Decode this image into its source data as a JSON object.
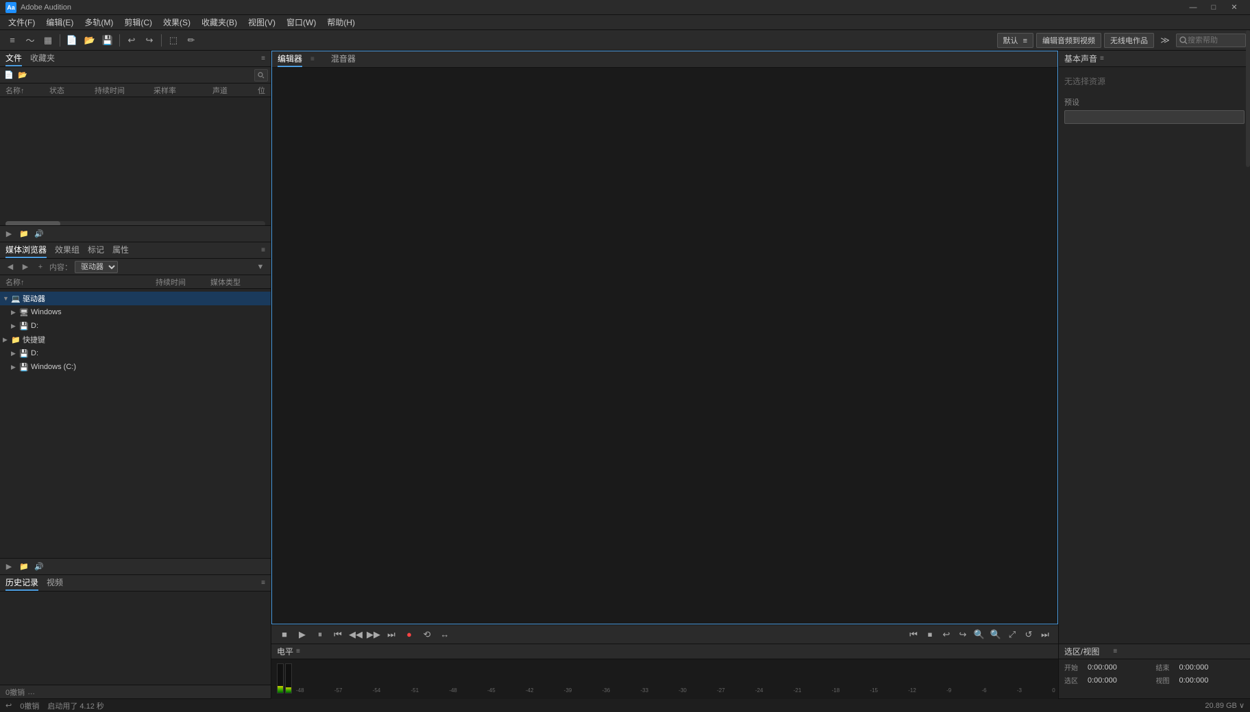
{
  "titlebar": {
    "app_name": "Adobe Audition",
    "logo_text": "Aa",
    "min_btn": "—",
    "max_btn": "□",
    "close_btn": "✕"
  },
  "menubar": {
    "items": [
      {
        "id": "file",
        "label": "文件(F)"
      },
      {
        "id": "edit",
        "label": "编辑(E)"
      },
      {
        "id": "multitrack",
        "label": "多轨(M)"
      },
      {
        "id": "clip",
        "label": "剪辑(C)"
      },
      {
        "id": "effect",
        "label": "效果(S)"
      },
      {
        "id": "favorites",
        "label": "收藏夹(B)"
      },
      {
        "id": "view",
        "label": "视图(V)"
      },
      {
        "id": "window",
        "label": "窗口(W)"
      },
      {
        "id": "help",
        "label": "帮助(H)"
      }
    ]
  },
  "toolbar": {
    "workspace_label": "默认",
    "workspace_icon": "≡",
    "edit_video_label": "编辑音频到视频",
    "wireless_label": "无线电作品",
    "expand_icon": "≫",
    "search_placeholder": "搜索帮助"
  },
  "left_panel": {
    "files_tab": "文件",
    "favorites_tab": "收藏夹",
    "menu_icon": "≡",
    "columns": {
      "name": "名称↑",
      "status": "状态",
      "duration": "持续时间",
      "samplerate": "采样率",
      "channel": "声道",
      "more": "位"
    },
    "bottom_icons": [
      "▶",
      "🗂",
      "🔊"
    ]
  },
  "media_browser": {
    "tabs": [
      {
        "id": "browser",
        "label": "媒体浏览器"
      },
      {
        "id": "effects",
        "label": "效果组"
      },
      {
        "id": "markers",
        "label": "标记"
      },
      {
        "id": "properties",
        "label": "属性"
      }
    ],
    "menu_icon": "≡",
    "content_label": "内容：",
    "content_value": "驱动器",
    "tree_items": [
      {
        "id": "drives",
        "label": "驱动器",
        "level": 0,
        "expanded": true,
        "icon": "💻",
        "type": "root"
      },
      {
        "id": "windows",
        "label": "Windows",
        "level": 1,
        "expanded": false,
        "icon": "🖥",
        "type": "drive"
      },
      {
        "id": "d_drive",
        "label": "D:",
        "level": 1,
        "expanded": false,
        "icon": "💾",
        "type": "drive"
      },
      {
        "id": "shortcuts",
        "label": "快捷键",
        "level": 0,
        "expanded": false,
        "icon": "📁",
        "type": "folder"
      },
      {
        "id": "d_right",
        "label": "D:",
        "level": 1,
        "expanded": false,
        "icon": "💾",
        "type": "drive"
      },
      {
        "id": "windows_c",
        "label": "Windows (C:)",
        "level": 1,
        "expanded": false,
        "icon": "💾",
        "type": "drive"
      }
    ],
    "col_name": "名称↑",
    "col_duration": "持续时间",
    "col_mediatype": "媒体类型",
    "bottom_icons": [
      "▶",
      "🗂",
      "🔊"
    ]
  },
  "history_panel": {
    "history_tab": "历史记录",
    "video_tab": "视频",
    "menu_icon": "≡",
    "undo_label": "0撤销",
    "undo_dots": "…"
  },
  "editor": {
    "tabs": [
      {
        "id": "editor",
        "label": "编辑器"
      },
      {
        "id": "mixer",
        "label": "混音器"
      }
    ],
    "editor_menu_icon": "≡",
    "mixer_menu_icon": ""
  },
  "transport": {
    "stop_icon": "■",
    "play_icon": "▶",
    "pause_icon": "⏸",
    "prev_icon": "⏮",
    "rewind_icon": "⏪",
    "forward_icon": "⏩",
    "next_icon": "⏭",
    "record_icon": "●",
    "loop_icon": "🔁",
    "auto_scroll_icon": "↔",
    "right_icons": [
      "⏮",
      "⏹",
      "↩",
      "↪",
      "🔍",
      "🔍",
      "🔍",
      "↺",
      "⏭"
    ]
  },
  "level_meter": {
    "label": "电平",
    "menu_icon": "≡",
    "scale_values": [
      "-48",
      "-57",
      "-54",
      "-51",
      "-48",
      "-45",
      "-42",
      "-39",
      "-36",
      "-33",
      "-30",
      "-27",
      "-24",
      "-21",
      "-18",
      "-15",
      "-12",
      "-9",
      "-6",
      "-3",
      "0"
    ]
  },
  "right_panel": {
    "title": "基本声音",
    "menu_icon": "≡",
    "no_resource": "无选择资源",
    "description_label": "预设",
    "description_placeholder": ""
  },
  "selection_panel": {
    "title": "选区/视图",
    "menu_icon": "≡",
    "start_label": "开始",
    "end_label": "结束",
    "selection_label": "选区",
    "view_label": "视图",
    "start_value": "0:00:000",
    "end_value": "0:00:000",
    "sel_start": "0:00:000",
    "sel_end": "0:00:000"
  },
  "status_bar": {
    "undo_label": "0撤销",
    "undo_icon": "↩",
    "startup_time": "启动用了 4.12 秒",
    "storage": "20.89 GB ∨"
  }
}
